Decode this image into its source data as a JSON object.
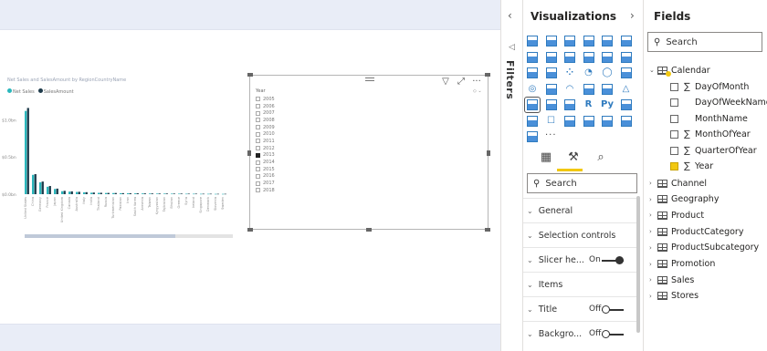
{
  "report": {
    "chart_title": "Net Sales and SalesAmount by RegionCountryName",
    "legend": [
      {
        "label": "Net Sales",
        "color": "#2ab7bc"
      },
      {
        "label": "SalesAmount",
        "color": "#1d3a4a"
      }
    ]
  },
  "chart_data": {
    "type": "bar",
    "title": "Net Sales and SalesAmount by RegionCountryName",
    "ylabel": "",
    "xlabel": "",
    "y_ticks": [
      "$0.0bn",
      "$0.5bn",
      "$1.0bn"
    ],
    "ylim": [
      0,
      1.3
    ],
    "categories": [
      "United States",
      "China",
      "Germany",
      "France",
      "Japan",
      "United Kingdom",
      "Canada",
      "Australia",
      "Italy",
      "India",
      "Thailand",
      "Russia",
      "Turkmenistan",
      "Pakistan",
      "Iran",
      "South Korea",
      "Armenia",
      "Taiwan",
      "Kyrgyzstan",
      "Tajikistan",
      "Bhutan",
      "Greece",
      "Syria",
      "Ireland",
      "Singapore",
      "Denmark",
      "Slovenia",
      "Sweden"
    ],
    "series": [
      {
        "name": "Net Sales",
        "values": [
          1.12,
          0.26,
          0.16,
          0.1,
          0.07,
          0.04,
          0.035,
          0.03,
          0.025,
          0.02,
          0.018,
          0.016,
          0.015,
          0.013,
          0.012,
          0.011,
          0.01,
          0.009,
          0.008,
          0.008,
          0.007,
          0.007,
          0.006,
          0.006,
          0.005,
          0.005,
          0.004,
          0.004
        ]
      },
      {
        "name": "SalesAmount",
        "values": [
          1.16,
          0.27,
          0.17,
          0.11,
          0.075,
          0.045,
          0.038,
          0.032,
          0.027,
          0.022,
          0.019,
          0.017,
          0.016,
          0.014,
          0.013,
          0.012,
          0.011,
          0.01,
          0.009,
          0.009,
          0.008,
          0.008,
          0.007,
          0.007,
          0.006,
          0.006,
          0.005,
          0.005
        ]
      }
    ],
    "colors": [
      "#2ab7bc",
      "#1d3a4a"
    ],
    "legend_position": "top-left",
    "grid": false
  },
  "slicer": {
    "header": "Year",
    "items": [
      {
        "label": "2005",
        "selected": false
      },
      {
        "label": "2006",
        "selected": false
      },
      {
        "label": "2007",
        "selected": false
      },
      {
        "label": "2008",
        "selected": false
      },
      {
        "label": "2009",
        "selected": false
      },
      {
        "label": "2010",
        "selected": false
      },
      {
        "label": "2011",
        "selected": false
      },
      {
        "label": "2012",
        "selected": false
      },
      {
        "label": "2013",
        "selected": true
      },
      {
        "label": "2014",
        "selected": false
      },
      {
        "label": "2015",
        "selected": false
      },
      {
        "label": "2016",
        "selected": false
      },
      {
        "label": "2017",
        "selected": false
      },
      {
        "label": "2018",
        "selected": false
      }
    ]
  },
  "filters": {
    "label": "Filters"
  },
  "visualizations": {
    "title": "Visualizations",
    "more": "···",
    "search_placeholder": "Search",
    "sections": [
      {
        "label": "General",
        "value": "",
        "toggle": ""
      },
      {
        "label": "Selection controls",
        "value": "",
        "toggle": ""
      },
      {
        "label": "Slicer he...",
        "value": "On",
        "toggle": "on"
      },
      {
        "label": "Items",
        "value": "",
        "toggle": ""
      },
      {
        "label": "Title",
        "value": "Off",
        "toggle": "off"
      },
      {
        "label": "Backgro...",
        "value": "Off",
        "toggle": "off"
      }
    ]
  },
  "fields": {
    "title": "Fields",
    "search_placeholder": "Search",
    "calendar": {
      "label": "Calendar",
      "columns": [
        {
          "label": "DayOfMonth",
          "sigma": true,
          "checked": false
        },
        {
          "label": "DayOfWeekName",
          "sigma": false,
          "checked": false
        },
        {
          "label": "MonthName",
          "sigma": false,
          "checked": false
        },
        {
          "label": "MonthOfYear",
          "sigma": true,
          "checked": false
        },
        {
          "label": "QuarterOfYear",
          "sigma": true,
          "checked": false
        },
        {
          "label": "Year",
          "sigma": true,
          "checked": true
        }
      ]
    },
    "tables": [
      "Channel",
      "Geography",
      "Product",
      "ProductCategory",
      "ProductSubcategory",
      "Promotion",
      "Sales",
      "Stores"
    ]
  }
}
